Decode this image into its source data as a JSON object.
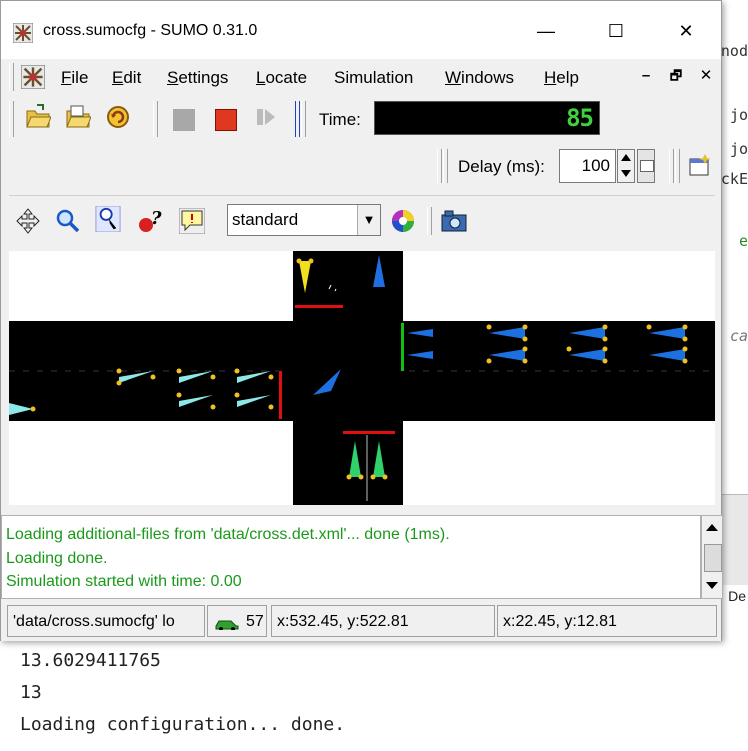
{
  "window": {
    "title": "cross.sumocfg - SUMO 0.31.0",
    "minimize_glyph": "—",
    "maximize_glyph": "☐",
    "close_glyph": "✕"
  },
  "menu": {
    "items": [
      {
        "first": "F",
        "rest": "ile"
      },
      {
        "first": "E",
        "rest": "dit"
      },
      {
        "first": "S",
        "rest": "ettings"
      },
      {
        "first": "L",
        "rest": "ocate"
      },
      {
        "first": "",
        "rest": "Simulation"
      },
      {
        "first": "W",
        "rest": "indows"
      },
      {
        "first": "H",
        "rest": "elp"
      }
    ],
    "mdi_minimize": "–",
    "mdi_restore": "🗗",
    "mdi_close": "✕"
  },
  "toolbar": {
    "time_label": "Time:",
    "time_value": "85",
    "delay_label": "Delay (ms):",
    "delay_value": "100"
  },
  "view": {
    "scheme": "standard",
    "scale_start": "0m",
    "scale_end": "10m"
  },
  "log": {
    "lines": [
      "Loading additional-files from 'data/cross.det.xml'... done (1ms).",
      "Loading done.",
      "Simulation started with time: 0.00"
    ]
  },
  "status": {
    "config": "'data/cross.sumocfg' lo",
    "vehicles": "57",
    "pos_network": "x:532.45, y:522.81",
    "pos_geo": "x:22.45, y:12.81"
  },
  "background": {
    "right_fragments": [
      "nod",
      "jo",
      "jo",
      "ckE",
      "e",
      "ca",
      "De"
    ],
    "console_lines": [
      "13.6029411765",
      "13",
      "Loading configuration... done."
    ]
  },
  "colors": {
    "time_green": "#3fd13f",
    "log_green": "#1a9a1a",
    "road": "#000000",
    "vehicle_cyan": "#8fe8e8",
    "vehicle_blue": "#1e6fe0",
    "vehicle_green": "#2fd36a",
    "vehicle_yellow": "#f0e020",
    "signal_red": "#e01010",
    "signal_green": "#10c010"
  }
}
